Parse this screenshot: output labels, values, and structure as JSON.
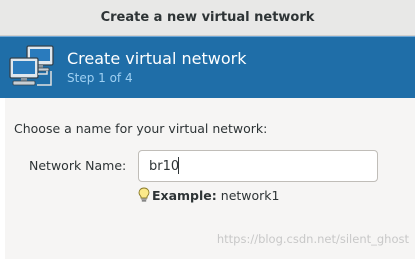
{
  "window": {
    "title": "Create a new virtual network"
  },
  "banner": {
    "icon": "network-computers-icon",
    "heading": "Create virtual network",
    "step": "Step 1 of 4",
    "color": "#1f6ea8"
  },
  "form": {
    "prompt": "Choose a name for your virtual network:",
    "network_name_label": "Network Name:",
    "network_name_value": "br10",
    "hint_icon": "lightbulb-icon",
    "hint_bold": "Example:",
    "hint_text": "network1"
  },
  "watermark": "https://blog.csdn.net/silent_ghost"
}
